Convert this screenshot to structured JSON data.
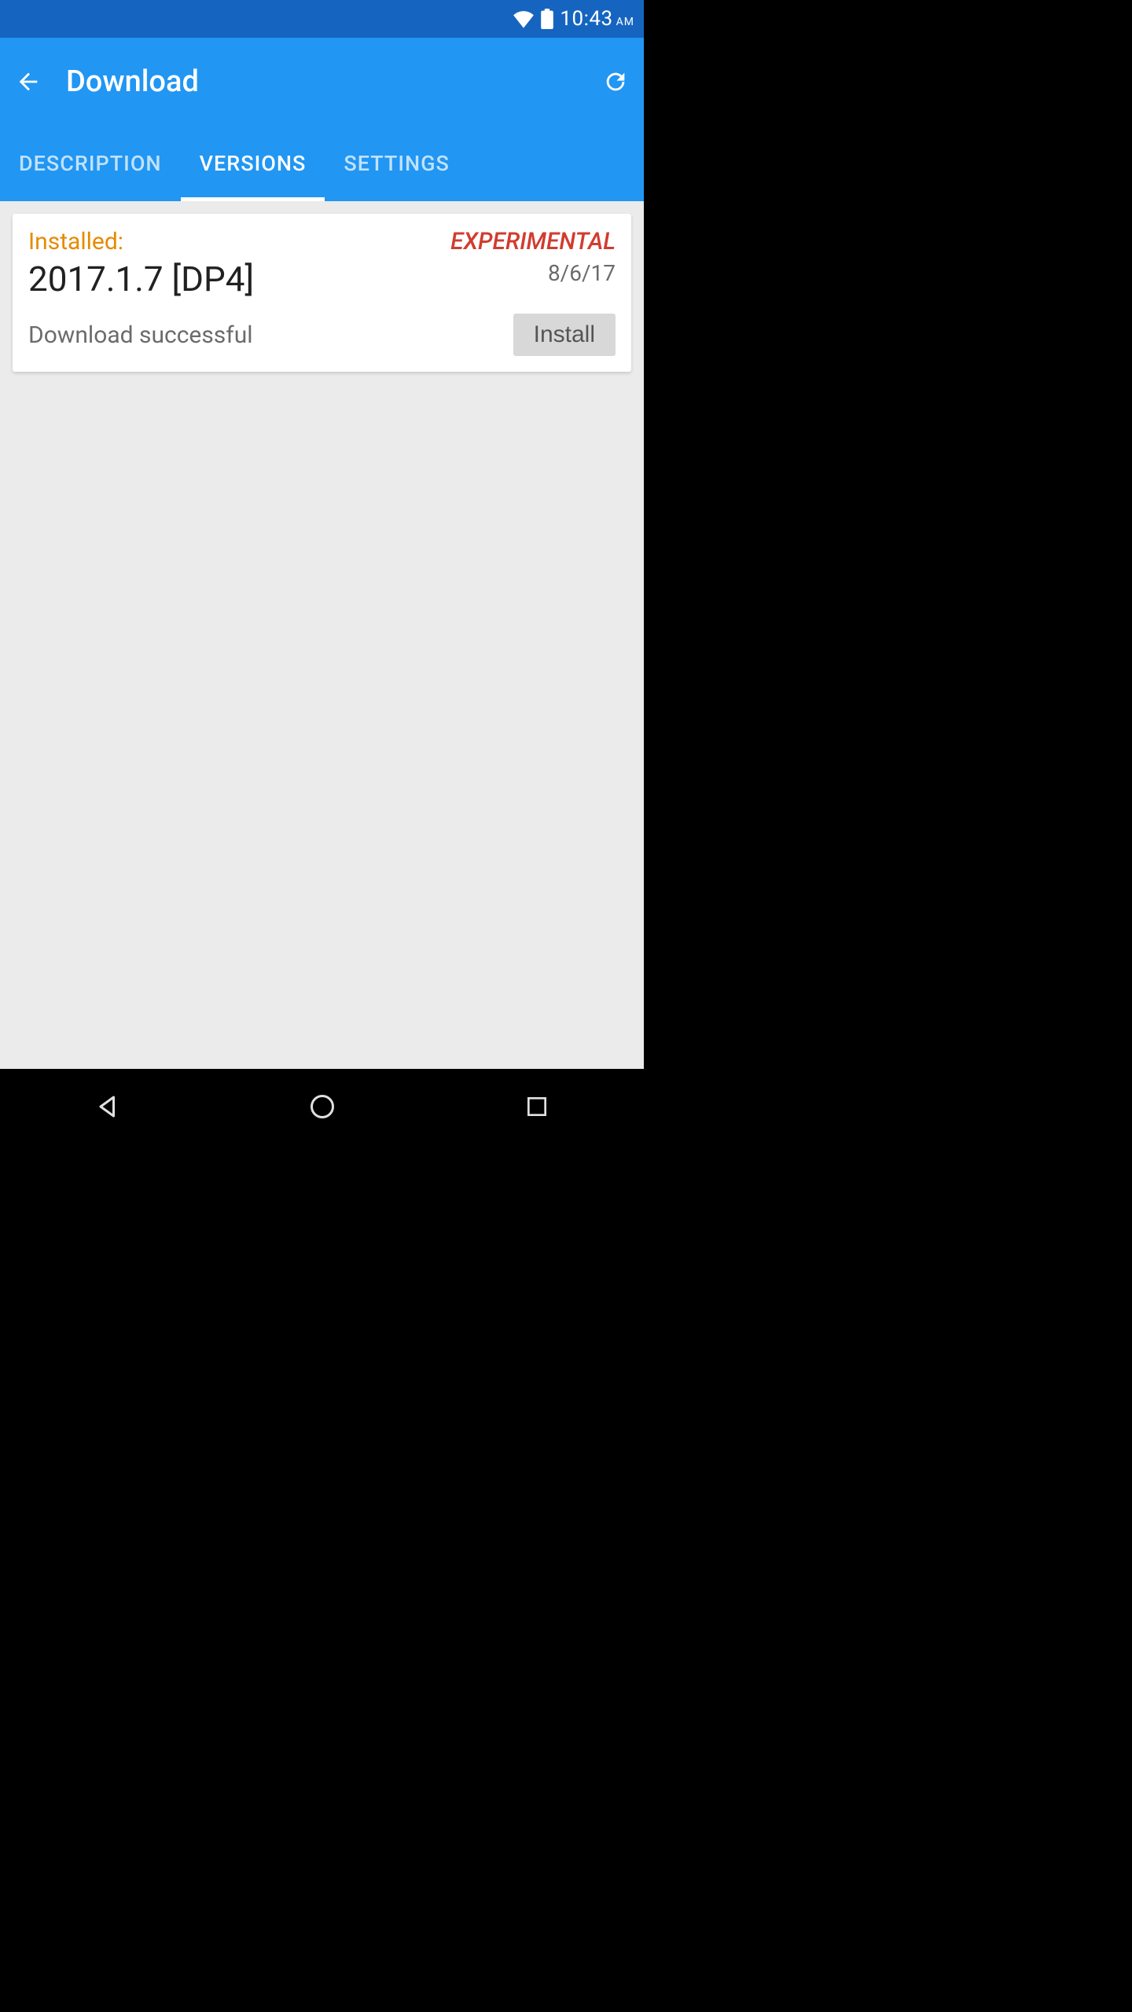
{
  "status_bar": {
    "time": "10:43",
    "ampm": "AM"
  },
  "app_bar": {
    "title": "Download"
  },
  "tabs": {
    "description": "DESCRIPTION",
    "versions": "VERSIONS",
    "settings": "SETTINGS"
  },
  "card": {
    "installed_label": "Installed:",
    "experimental_label": "EXPERIMENTAL",
    "version": "2017.1.7 [DP4]",
    "date": "8/6/17",
    "status": "Download successful",
    "install_button": "Install"
  }
}
